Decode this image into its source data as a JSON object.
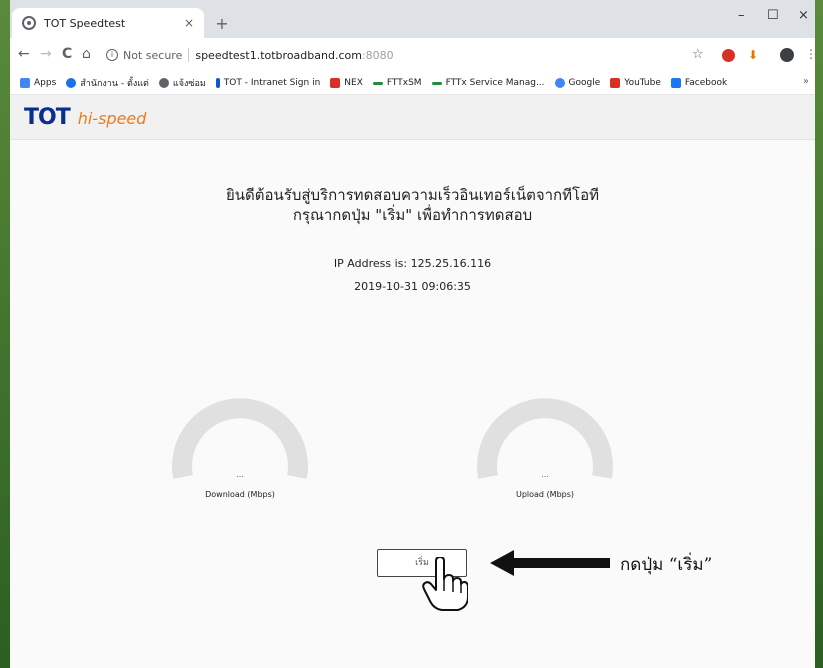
{
  "browser": {
    "tab_title": "TOT Speedtest",
    "tab_close": "×",
    "new_tab": "+",
    "win_min": "–",
    "win_max": "☐",
    "win_close": "×",
    "nav_back": "←",
    "nav_forward": "→",
    "nav_reload": "C",
    "nav_home": "⌂",
    "not_secure": "Not secure",
    "url_host": "speedtest1.totbroadband.com",
    "url_port": ":8080",
    "star": "☆",
    "menu": "⋮"
  },
  "bookmarks": [
    {
      "label": "Apps",
      "color": "#4285f4"
    },
    {
      "label": "สำนักงาน - ตั้งแต่",
      "color": "#1a73e8"
    },
    {
      "label": "แจ้งซ่อม",
      "color": "#5f6368"
    },
    {
      "label": "TOT - Intranet Sign in",
      "color": "#0b57d0"
    },
    {
      "label": "NEX",
      "color": "#d93025"
    },
    {
      "label": "FTTxSM",
      "color": "#1e8e3e"
    },
    {
      "label": "FTTx Service Manag...",
      "color": "#1e8e3e"
    },
    {
      "label": "Google",
      "color": "#4285f4"
    },
    {
      "label": "YouTube",
      "color": "#d93025"
    },
    {
      "label": "Facebook",
      "color": "#1877f2"
    }
  ],
  "bookmarks_more": "»",
  "site": {
    "logo_brand": "TOT",
    "logo_tagline": "hi-speed",
    "welcome_line1": "ยินดีต้อนรับสู่บริการทดสอบความเร็วอินเทอร์เน็ตจากทีโอที",
    "welcome_line2": "กรุณากดปุ่ม \"เริ่ม\" เพื่อทำการทดสอบ",
    "ip_text": "IP Address is: 125.25.16.116",
    "datetime": "2019-10-31 09:06:35",
    "download_value": "...",
    "download_label": "Download (Mbps)",
    "upload_value": "...",
    "upload_label": "Upload (Mbps)",
    "start_button": "เริ่ม"
  },
  "annotation": "กดปุ่ม “เริ่ม”",
  "colors": {
    "brand_blue": "#0b2d8f",
    "brand_orange": "#f07b1b",
    "gauge": "#e0e0e0"
  }
}
